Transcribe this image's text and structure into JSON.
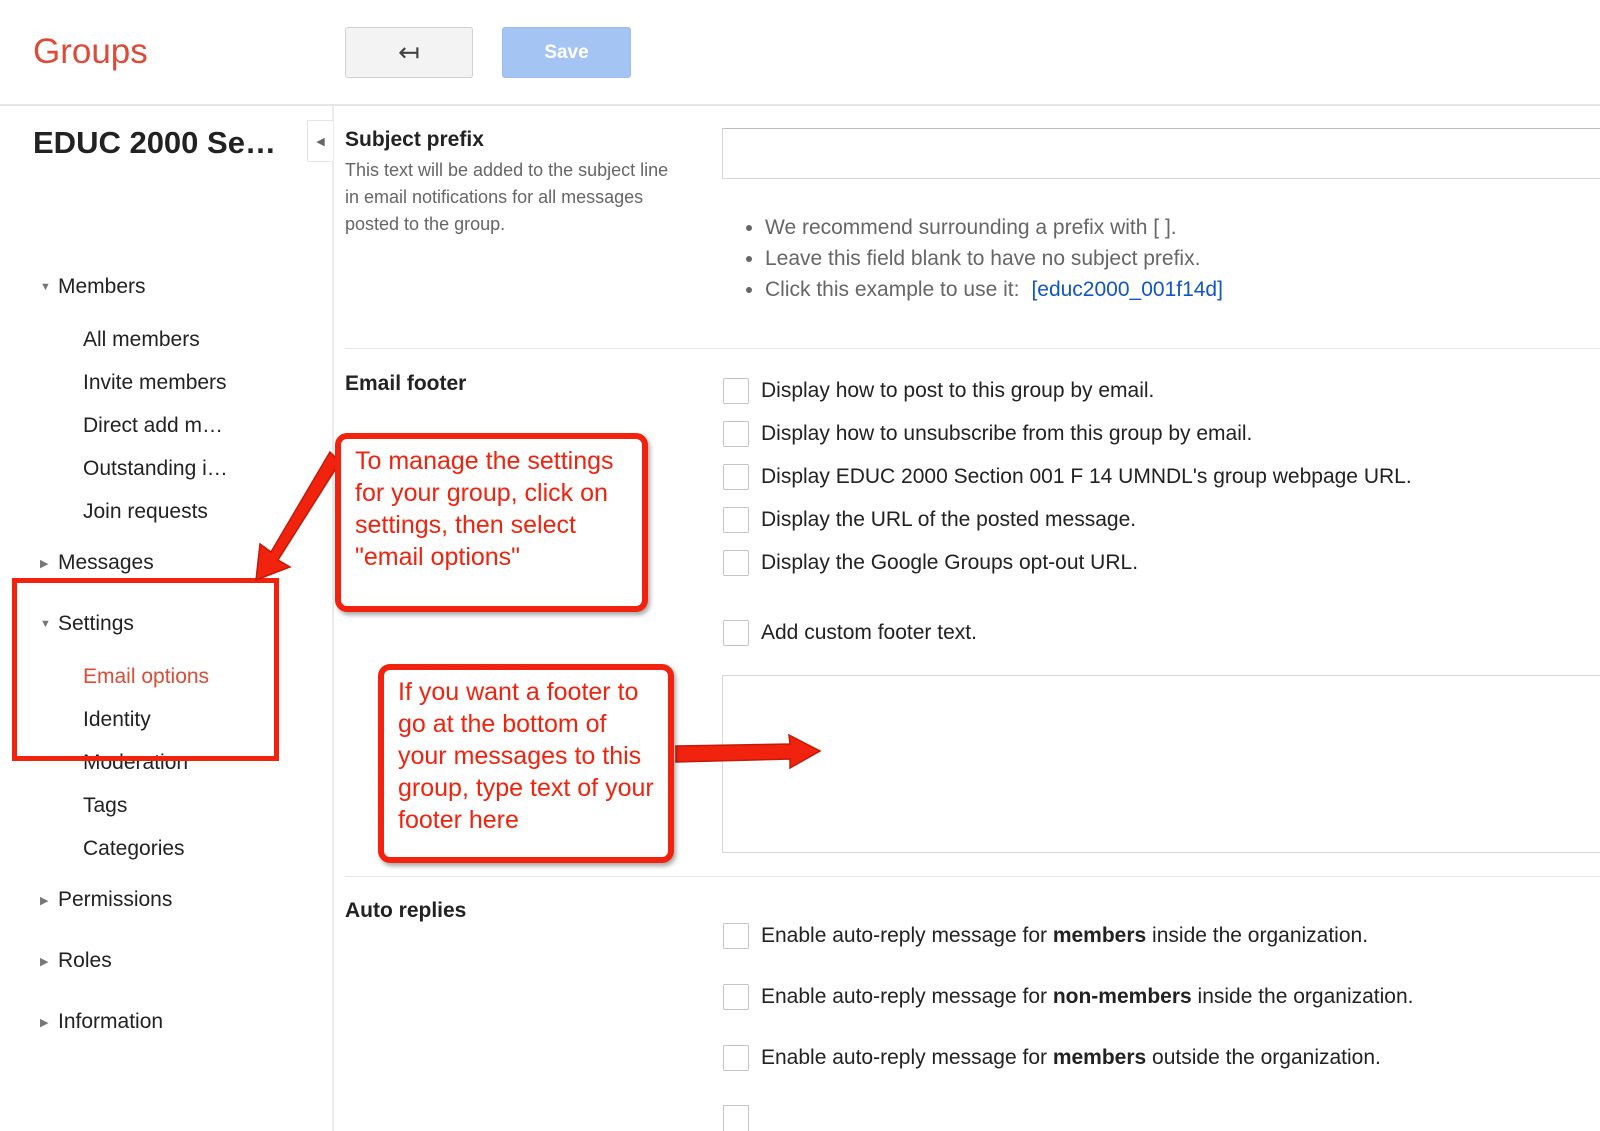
{
  "header": {
    "logo": "Groups",
    "back_icon": "back-arrow-icon",
    "back_glyph": "↤",
    "save_label": "Save"
  },
  "sidebar": {
    "group_title": "EDUC 2000 Se…",
    "collapse_glyph": "◀",
    "sections": [
      {
        "label": "Members",
        "expanded": true,
        "items": [
          "All members",
          "Invite members",
          "Direct add m…",
          "Outstanding i…",
          "Join requests"
        ]
      },
      {
        "label": "Messages",
        "expanded": false
      },
      {
        "label": "Settings",
        "expanded": true,
        "items": [
          "Email options",
          "Identity",
          "Moderation",
          "Tags",
          "Categories"
        ],
        "active": "Email options"
      },
      {
        "label": "Permissions",
        "expanded": false
      },
      {
        "label": "Roles",
        "expanded": false
      },
      {
        "label": "Information",
        "expanded": false
      }
    ]
  },
  "main": {
    "subject_prefix": {
      "title": "Subject prefix",
      "description": "This text will be added to the subject line in email notifications for all messages posted to the group.",
      "value": "",
      "tips": [
        "We recommend surrounding a prefix with [ ].",
        "Leave this field blank to have no subject prefix.",
        "Click this example to use it:"
      ],
      "example_link": "[educ2000_001f14d]"
    },
    "email_footer": {
      "title": "Email footer",
      "options": [
        "Display how to post to this group by email.",
        "Display how to unsubscribe from this group by email.",
        "Display EDUC 2000 Section 001 F 14 UMNDL's group webpage URL.",
        "Display the URL of the posted message.",
        "Display the Google Groups opt-out URL."
      ],
      "custom_label": "Add custom footer text.",
      "custom_text": ""
    },
    "auto_replies": {
      "title": "Auto replies",
      "options": [
        {
          "pre": "Enable auto-reply message for ",
          "bold": "members",
          "post": " inside the organization."
        },
        {
          "pre": "Enable auto-reply message for ",
          "bold": "non-members",
          "post": " inside the organization."
        },
        {
          "pre": "Enable auto-reply message for ",
          "bold": "members",
          "post": " outside the organization."
        }
      ]
    }
  },
  "annotations": {
    "callout1": "To manage the settings for your group, click on settings, then select \"email options\"",
    "callout2": "If you want a footer to go at the bottom of your messages to this group, type text of your footer here",
    "color": "#f2230e"
  }
}
